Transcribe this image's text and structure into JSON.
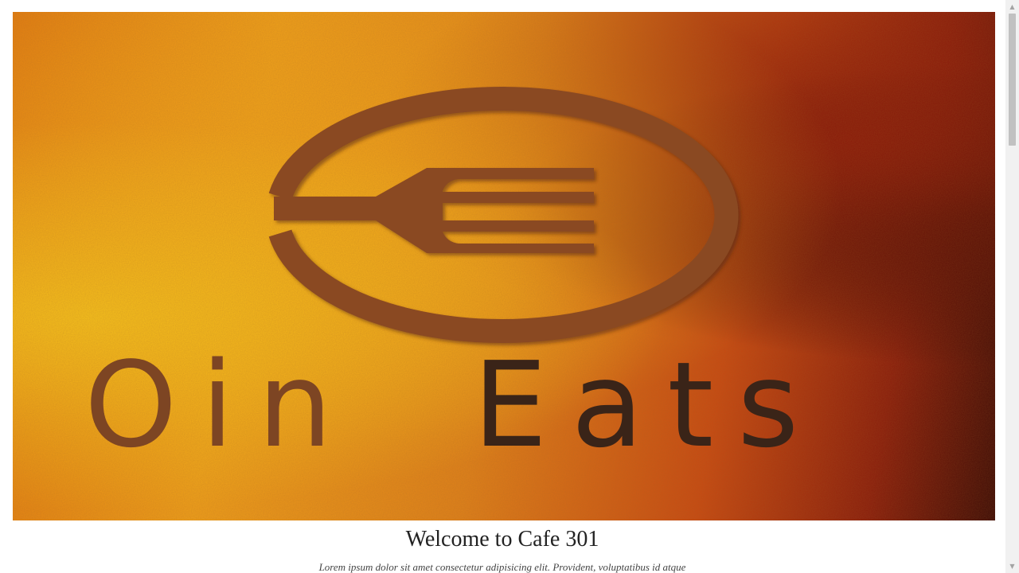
{
  "hero": {
    "logo_text": "OinEats",
    "logo_part_light": "Oin",
    "logo_part_dark": "Eats"
  },
  "content": {
    "heading": "Welcome to Cafe 301",
    "paragraph": "Lorem ipsum dolor sit amet consectetur adipisicing elit. Provident, voluptatibus id atque"
  },
  "scrollbar": {
    "up_icon": "triangle-up",
    "down_icon": "triangle-down",
    "up_glyph": "▲",
    "down_glyph": "▼",
    "position_fraction": 0.0
  },
  "colors": {
    "logo_brown": "#8a4a22",
    "logo_dark": "#3a2418",
    "accent_orange": "#f0a01a"
  }
}
